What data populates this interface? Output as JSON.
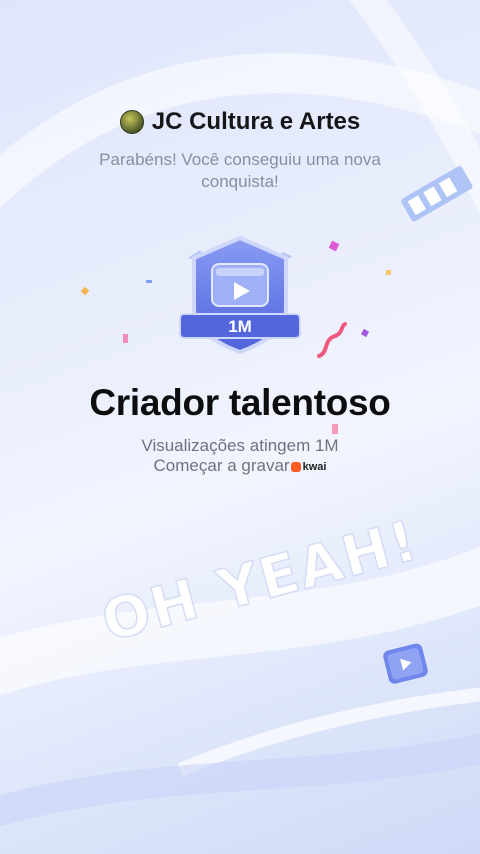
{
  "header": {
    "channel_name": "JC Cultura e Artes",
    "subtitle": "Parabéns! Você conseguiu uma nova conquista!"
  },
  "badge": {
    "label": "1M"
  },
  "achievement": {
    "title": "Criador talentoso",
    "description_line1": "Visualizações atingem 1M",
    "description_line2": "Começar a gravar",
    "brand": "kwai"
  },
  "overlay": {
    "text": "OH YEAH!"
  },
  "colors": {
    "accent": "#5b6fe6",
    "badge_fill": "#6478ea",
    "badge_label": "#ffffff",
    "brand": "#ff5a1f"
  }
}
